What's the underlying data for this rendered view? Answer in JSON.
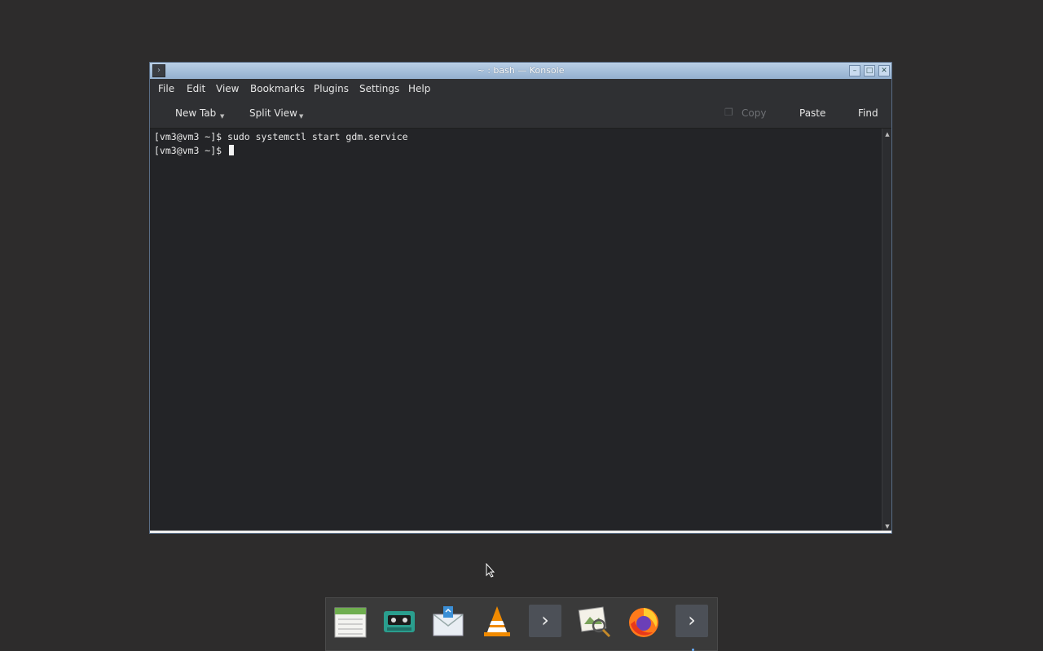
{
  "window": {
    "title": "~ : bash — Konsole",
    "controls": {
      "minimize": "–",
      "maximize": "□",
      "close": "✕"
    }
  },
  "menubar": {
    "items": [
      "File",
      "Edit",
      "View",
      "Bookmarks",
      "Plugins",
      "Settings",
      "Help"
    ]
  },
  "toolbar": {
    "new_tab": "New Tab",
    "split_view": "Split View",
    "copy": "Copy",
    "paste": "Paste",
    "find": "Find"
  },
  "terminal": {
    "lines": [
      "[vm3@vm3 ~]$ sudo systemctl start gdm.service",
      "[vm3@vm3 ~]$ "
    ]
  },
  "dock": {
    "items": [
      {
        "name": "calendar-app-icon"
      },
      {
        "name": "cassette-player-icon"
      },
      {
        "name": "mail-client-icon"
      },
      {
        "name": "vlc-media-player-icon"
      },
      {
        "name": "terminal-icon"
      },
      {
        "name": "image-viewer-icon"
      },
      {
        "name": "firefox-icon"
      },
      {
        "name": "terminal-icon-2"
      }
    ]
  },
  "colors": {
    "titlebar": "#a6c0dc",
    "terminal_bg": "#232427",
    "desktop_bg": "#2d2c2c"
  }
}
